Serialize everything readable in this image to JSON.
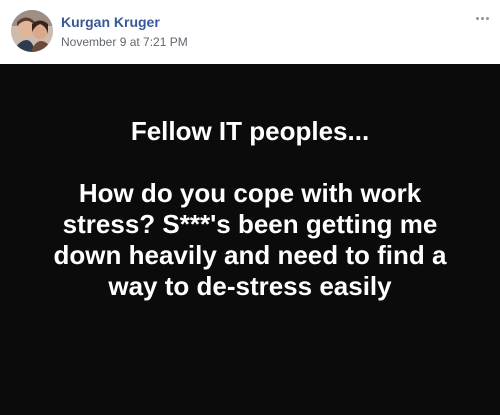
{
  "post": {
    "author": "Kurgan Kruger",
    "timestamp": "November 9 at 7:21 PM",
    "more_icon": "more-horizontal-icon",
    "status_background": "#0b0b0b",
    "status_text_color": "#ffffff",
    "status_heading": "Fellow IT peoples...",
    "status_body": "How do you cope with work stress? S***'s been getting me down heavily and need to find a way to de-stress easily"
  }
}
